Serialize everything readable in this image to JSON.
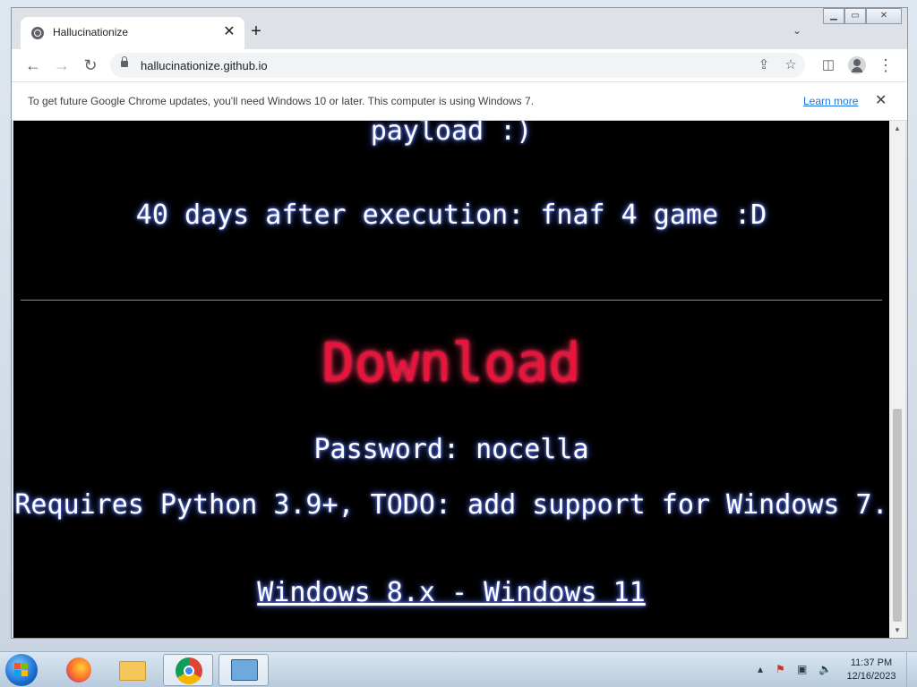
{
  "browser": {
    "tab_title": "Hallucinationize",
    "url": "hallucinationize.github.io",
    "infobar_text": "To get future Google Chrome updates, you'll need Windows 10 or later. This computer is using Windows 7.",
    "learn_more": "Learn more"
  },
  "page": {
    "line1": "payload :)",
    "line2": "40 days after execution: fnaf 4 game :D",
    "download_heading": "Download",
    "password_text": "Password: nocella",
    "requires_text": "Requires Python 3.9+, TODO: add support for Windows 7.",
    "download_link": "Windows 8.x - Windows 11",
    "accent_color": "#e8143c",
    "glow_color": "#4a6bff"
  },
  "taskbar": {
    "time": "11:37 PM",
    "date": "12/16/2023"
  }
}
